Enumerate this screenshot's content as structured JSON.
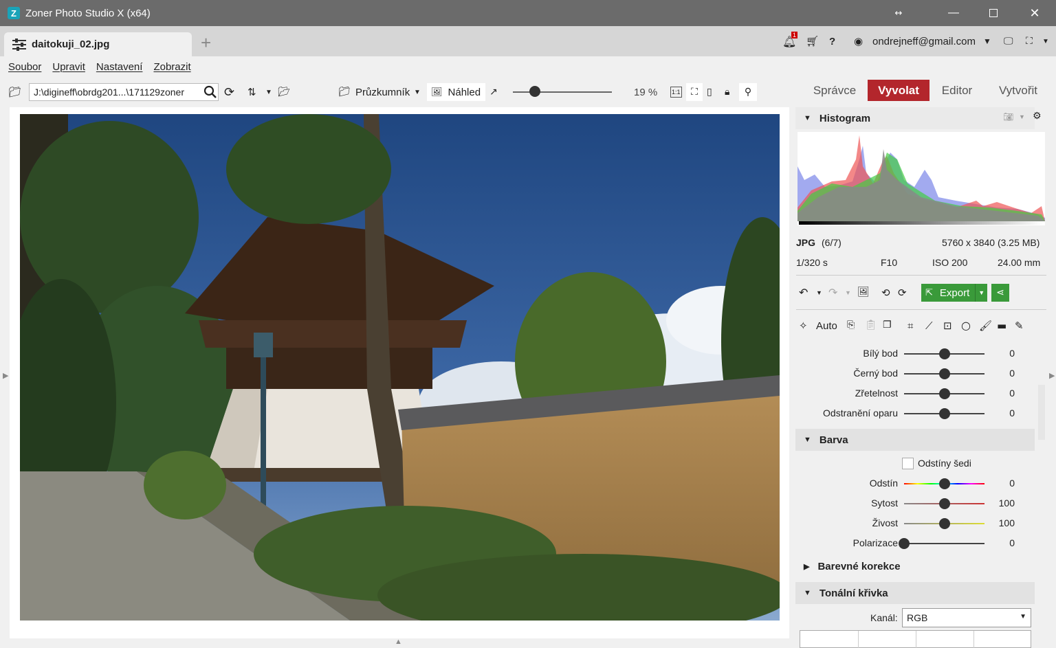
{
  "window": {
    "title": "Zoner Photo Studio X (x64)",
    "app_icon": "zps-app-icon"
  },
  "tabs": [
    {
      "label": "daitokuji_02.jpg"
    }
  ],
  "account": {
    "email": "ondrejneff@gmail.com",
    "notification_count": "1"
  },
  "menu": [
    "Soubor",
    "Upravit",
    "Nastavení",
    "Zobrazit"
  ],
  "toolbar": {
    "path": "J:\\digineff\\obrdg201...\\171129zoner",
    "navigator_label": "Průzkumník",
    "preview_label": "Náhled",
    "zoom": "19 %",
    "zoom_slider_fraction": 0.22
  },
  "modes": [
    {
      "label": "Správce",
      "active": false
    },
    {
      "label": "Vyvolat",
      "active": true
    },
    {
      "label": "Editor",
      "active": false
    },
    {
      "label": "Vytvořit",
      "active": false
    }
  ],
  "histogram": {
    "title": "Histogram"
  },
  "file_info": {
    "format": "JPG",
    "index": "(6/7)",
    "dimensions": "5760 x 3840 (3.25 MB)",
    "shutter": "1/320 s",
    "aperture": "F10",
    "iso": "ISO 200",
    "focal": "24.00 mm"
  },
  "actions": {
    "export_label": "Export",
    "auto_label": "Auto"
  },
  "adjust_top": [
    {
      "label": "Bílý bod",
      "value": "0",
      "position": 0.5
    },
    {
      "label": "Černý bod",
      "value": "0",
      "position": 0.5
    },
    {
      "label": "Zřetelnost",
      "value": "0",
      "position": 0.5
    },
    {
      "label": "Odstranění oparu",
      "value": "0",
      "position": 0.5
    }
  ],
  "color_section": {
    "title": "Barva",
    "grayscale_label": "Odstíny šedi",
    "grayscale_checked": false,
    "rows": [
      {
        "label": "Odstín",
        "value": "0",
        "position": 0.5
      },
      {
        "label": "Sytost",
        "value": "100",
        "position": 0.5
      },
      {
        "label": "Živost",
        "value": "100",
        "position": 0.5
      },
      {
        "label": "Polarizace",
        "value": "0",
        "position": 0.0
      }
    ]
  },
  "color_correction": {
    "title": "Barevné korekce"
  },
  "tone_curve": {
    "title": "Tonální křivka",
    "channel_label": "Kanál:",
    "channel_value": "RGB"
  },
  "colors": {
    "accent_red": "#b3262c",
    "export_green": "#3a9a3a",
    "titlebar": "#6b6b6b"
  }
}
